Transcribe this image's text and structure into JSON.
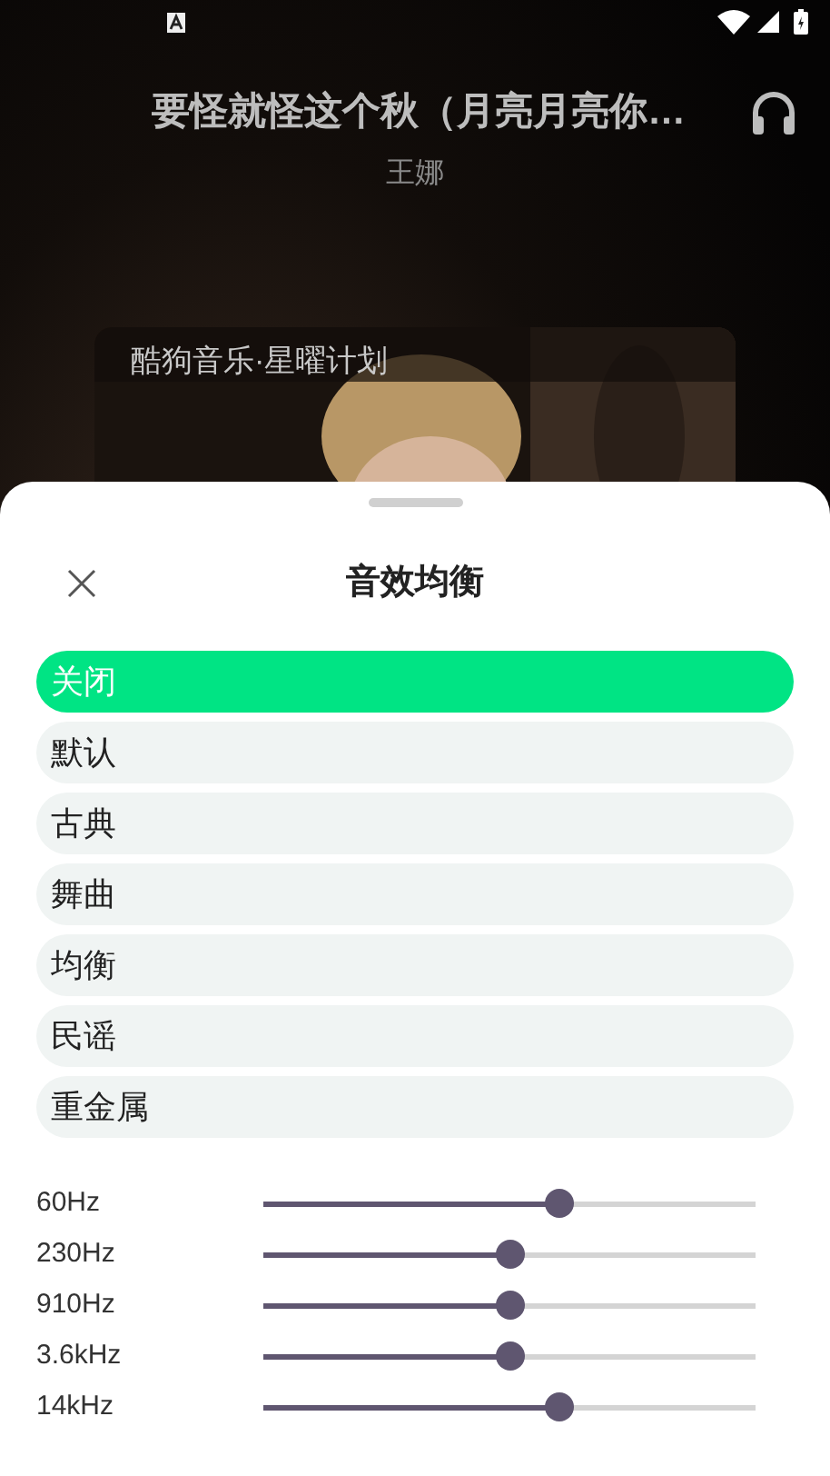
{
  "player": {
    "title": "要怪就怪这个秋（月亮月亮你…",
    "artist": "王娜",
    "card_caption": "酷狗音乐·星曜计划"
  },
  "sheet": {
    "title": "音效均衡",
    "presets": [
      {
        "label": "关闭",
        "selected": true
      },
      {
        "label": "默认",
        "selected": false
      },
      {
        "label": "古典",
        "selected": false
      },
      {
        "label": "舞曲",
        "selected": false
      },
      {
        "label": "均衡",
        "selected": false
      },
      {
        "label": "民谣",
        "selected": false
      },
      {
        "label": "重金属",
        "selected": false
      }
    ],
    "bands": [
      {
        "label": "60Hz",
        "level": 0.6
      },
      {
        "label": "230Hz",
        "level": 0.5
      },
      {
        "label": "910Hz",
        "level": 0.5
      },
      {
        "label": "3.6kHz",
        "level": 0.5
      },
      {
        "label": "14kHz",
        "level": 0.6
      }
    ]
  }
}
